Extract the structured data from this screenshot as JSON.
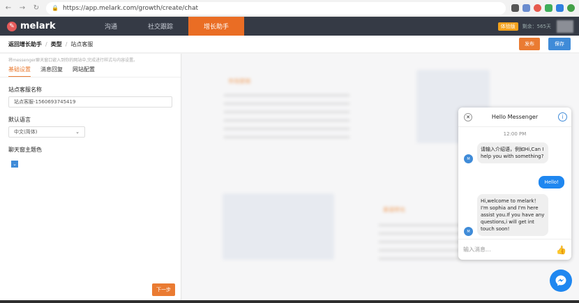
{
  "browser": {
    "url": "https://app.melark.com/growth/create/chat"
  },
  "app": {
    "logo": "melark",
    "nav": [
      "沟通",
      "社交跟踪",
      "增长助手"
    ],
    "trial_badge": "体验版",
    "trial_text": "剩余：565天"
  },
  "breadcrumb": {
    "back": "返回增长助手",
    "type": "类型",
    "current": "站点客服",
    "publish": "发布",
    "save": "保存"
  },
  "form": {
    "hint": "将messenger聊天窗口嵌入到你的网站中,完成进行样式与内容设置。",
    "tabs": [
      "基础设置",
      "消息回复",
      "网站配置"
    ],
    "name_label": "站点客服名称",
    "name_value": "站点客服-1560693745419",
    "lang_label": "默认语言",
    "lang_value": "中文(简体)",
    "color_label": "聊天窗主题色",
    "next": "下一步"
  },
  "preview": {
    "h1": "市场营销",
    "h2": "渠道转化"
  },
  "messenger": {
    "title": "Hello Messenger",
    "time": "12:00 PM",
    "msg1": "请输入介绍语，例如Hi,Can I help you with something?",
    "hello": "Hello!",
    "msg2": "Hi,welcome to melark！ I'm sophia and I'm here assist you.If you have any questions,i will get int touch soon!",
    "avatar": "M",
    "placeholder": "输入消息..."
  }
}
